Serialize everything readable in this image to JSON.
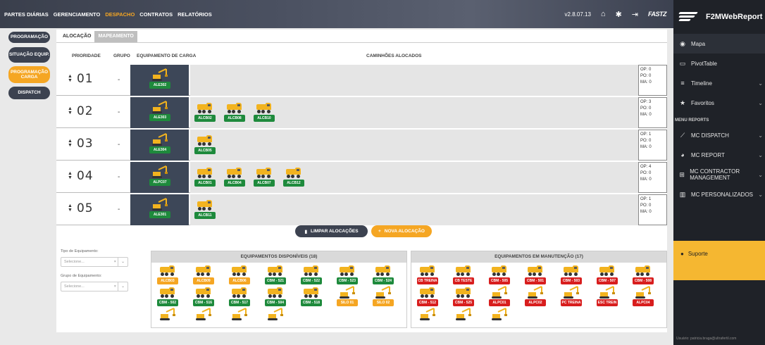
{
  "topbar": {
    "nav": [
      "PARTES DIÁRIAS",
      "GERENCIAMENTO",
      "DESPACHO",
      "CONTRATOS",
      "RELATÓRIOS"
    ],
    "active_index": 2,
    "version": "v2.8.07.13",
    "logo_text": "FASTZ",
    "icons": [
      "home-icon",
      "gear-icon",
      "logout-icon"
    ]
  },
  "left_menu": [
    {
      "label": "PROGRAMAÇÃO",
      "active": false
    },
    {
      "label": "SITUAÇÃO EQUIP.",
      "active": false
    },
    {
      "label": "PROGRAMAÇÃO CARGA",
      "active": true
    },
    {
      "label": "DISPATCH",
      "active": false
    }
  ],
  "tabs": {
    "allocation": "ALOCAÇÃO",
    "mapping": "MAPEAMENTO"
  },
  "table": {
    "headers": {
      "priority": "PRIORIDADE",
      "group": "GRUPO",
      "equipment": "EQUIPAMENTO DE CARGA",
      "trucks": "CAMINHÕES ALOCADOS"
    },
    "rows": [
      {
        "priority": "01",
        "group": "-",
        "equipment": "ALE302",
        "trucks": [],
        "op": "OP: 0",
        "po": "PO: 0",
        "ma": "MA: 0"
      },
      {
        "priority": "02",
        "group": "-",
        "equipment": "ALE303",
        "trucks": [
          "ALCB02",
          "ALCB08",
          "ALCB10"
        ],
        "op": "OP: 3",
        "po": "PO: 0",
        "ma": "MA: 0"
      },
      {
        "priority": "03",
        "group": "-",
        "equipment": "ALE304",
        "trucks": [
          "ALCB05"
        ],
        "op": "OP: 1",
        "po": "PO: 0",
        "ma": "MA: 0"
      },
      {
        "priority": "04",
        "group": "-",
        "equipment": "ALPC07",
        "trucks": [
          "ALCB01",
          "ALCB04",
          "ALCB07",
          "ALCB12"
        ],
        "op": "OP: 4",
        "po": "PO: 0",
        "ma": "MA: 0"
      },
      {
        "priority": "05",
        "group": "-",
        "equipment": "ALE301",
        "trucks": [
          "ALCB11"
        ],
        "op": "OP: 1",
        "po": "PO: 0",
        "ma": "MA: 0"
      }
    ]
  },
  "buttons": {
    "clear": "LIMPAR ALOCAÇÕES",
    "new": "NOVA ALOCAÇÃO"
  },
  "filters": {
    "type_label": "Tipo de Equipamento:",
    "type_placeholder": "Selecione...",
    "group_label": "Grupo de Equipamento:",
    "group_placeholder": "Selecione..."
  },
  "available": {
    "title": "EQUIPAMENTOS DISPONÍVEIS (18)",
    "items": [
      {
        "label": "ALCB03",
        "kind": "truck",
        "color": "o"
      },
      {
        "label": "ALCB09",
        "kind": "truck",
        "color": "o"
      },
      {
        "label": "ALCB06",
        "kind": "truck",
        "color": "o"
      },
      {
        "label": "CBM - 521",
        "kind": "truck",
        "color": "g"
      },
      {
        "label": "CBM - 522",
        "kind": "truck",
        "color": "g"
      },
      {
        "label": "CBM - 523",
        "kind": "truck",
        "color": "g"
      },
      {
        "label": "CBM - 524",
        "kind": "truck",
        "color": "g"
      },
      {
        "label": "CBM - 502",
        "kind": "truck",
        "color": "g"
      },
      {
        "label": "CBM - 516",
        "kind": "truck",
        "color": "g"
      },
      {
        "label": "CBM - 517",
        "kind": "truck",
        "color": "g"
      },
      {
        "label": "CBM - 504",
        "kind": "truck",
        "color": "g"
      },
      {
        "label": "CBM - 518",
        "kind": "truck",
        "color": "g"
      },
      {
        "label": "SILO 01",
        "kind": "exc",
        "color": "o"
      },
      {
        "label": "SILO 02",
        "kind": "exc",
        "color": "o"
      },
      {
        "label": "",
        "kind": "exc",
        "color": "g"
      },
      {
        "label": "",
        "kind": "exc",
        "color": "g"
      },
      {
        "label": "",
        "kind": "exc",
        "color": "g"
      },
      {
        "label": "",
        "kind": "exc",
        "color": "g"
      }
    ]
  },
  "maintenance": {
    "title": "EQUIPAMENTOS EM MANUTENÇÃO (17)",
    "items": [
      {
        "label": "CB TREINA",
        "kind": "truck",
        "color": "r"
      },
      {
        "label": "CB TESTE",
        "kind": "truck",
        "color": "r"
      },
      {
        "label": "CBM - 505",
        "kind": "truck",
        "color": "r"
      },
      {
        "label": "CBM - 501",
        "kind": "truck",
        "color": "r"
      },
      {
        "label": "CBM - 503",
        "kind": "truck",
        "color": "r"
      },
      {
        "label": "CBM - 507",
        "kind": "truck",
        "color": "r"
      },
      {
        "label": "CBM - 508",
        "kind": "truck",
        "color": "r"
      },
      {
        "label": "CBM - 512",
        "kind": "truck",
        "color": "r"
      },
      {
        "label": "CBM - 525",
        "kind": "truck",
        "color": "r"
      },
      {
        "label": "ALPC01",
        "kind": "exc",
        "color": "r"
      },
      {
        "label": "ALPC02",
        "kind": "exc",
        "color": "r"
      },
      {
        "label": "PC TREINA",
        "kind": "exc",
        "color": "r"
      },
      {
        "label": "ESC TREIN",
        "kind": "exc",
        "color": "r"
      },
      {
        "label": "ALPC04",
        "kind": "exc",
        "color": "r"
      },
      {
        "label": "",
        "kind": "exc",
        "color": "r"
      },
      {
        "label": "",
        "kind": "exc",
        "color": "r"
      },
      {
        "label": "",
        "kind": "exc",
        "color": "r"
      }
    ]
  },
  "right_sidebar": {
    "brand": "F2MWebReport",
    "items": [
      {
        "label": "Mapa",
        "icon": "globe-icon",
        "glyph": "◉",
        "chevron": false,
        "active": true
      },
      {
        "label": "PivotTable",
        "icon": "monitor-icon",
        "glyph": "▭",
        "chevron": false,
        "active": false
      },
      {
        "label": "Timeline",
        "icon": "list-icon",
        "glyph": "≡",
        "chevron": true,
        "active": false
      },
      {
        "label": "Favoritos",
        "icon": "star-icon",
        "glyph": "★",
        "chevron": true,
        "active": false
      }
    ],
    "section": "MENU REPORTS",
    "reports": [
      {
        "label": "MC DISPATCH",
        "icon": "line-chart-icon",
        "glyph": "⟋"
      },
      {
        "label": "MC REPORT",
        "icon": "pie-chart-icon",
        "glyph": "◕"
      },
      {
        "label": "MC CONTRACTOR MANAGEMENT",
        "icon": "sitemap-icon",
        "glyph": "⊞"
      },
      {
        "label": "MC PERSONALIZADOS",
        "icon": "bar-chart-icon",
        "glyph": "▥"
      }
    ],
    "support": "Suporte",
    "footer": "Usuário: patricia.braga@ultrafertil.com"
  }
}
